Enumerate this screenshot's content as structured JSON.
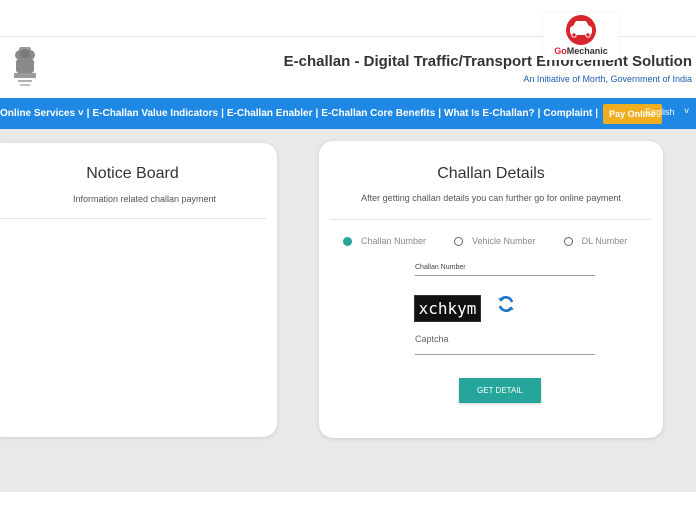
{
  "header": {
    "title": "E-challan - Digital Traffic/Transport Enforcement Solution",
    "subtitle": "An Initiative of Morth, Government of India",
    "emblem_icon": "national-emblem-icon"
  },
  "watermark": {
    "brand_prefix": "Go",
    "brand_suffix": "Mechanic",
    "icon": "car-icon",
    "color": "#d9262c"
  },
  "navbar": {
    "items": [
      "Online Services ˅",
      "E-Challan Value Indicators",
      "E-Challan Enabler",
      "E-Challan Core Benefits",
      "What Is E-Challan?",
      "Complaint"
    ],
    "separator": "|",
    "pay_online": "Pay Online",
    "language": "English",
    "language_caret": "˅",
    "bg_color": "#1f88e5",
    "pay_color": "#f0ad1e"
  },
  "notice_board": {
    "title": "Notice Board",
    "subtitle": "Information related challan payment"
  },
  "challan": {
    "title": "Challan Details",
    "subtitle": "After getting challan details you can further go for online payment",
    "options": [
      "Challan Number",
      "Vehicle Number",
      "DL Number"
    ],
    "selected_option": "Challan Number",
    "challan_number_label": "Challan Number",
    "challan_number_value": "",
    "captcha_text": "xchkym",
    "captcha_placeholder": "Captcha",
    "refresh_icon": "refresh-icon",
    "submit_label": "GET DETAIL",
    "accent_color": "#26a69a"
  }
}
